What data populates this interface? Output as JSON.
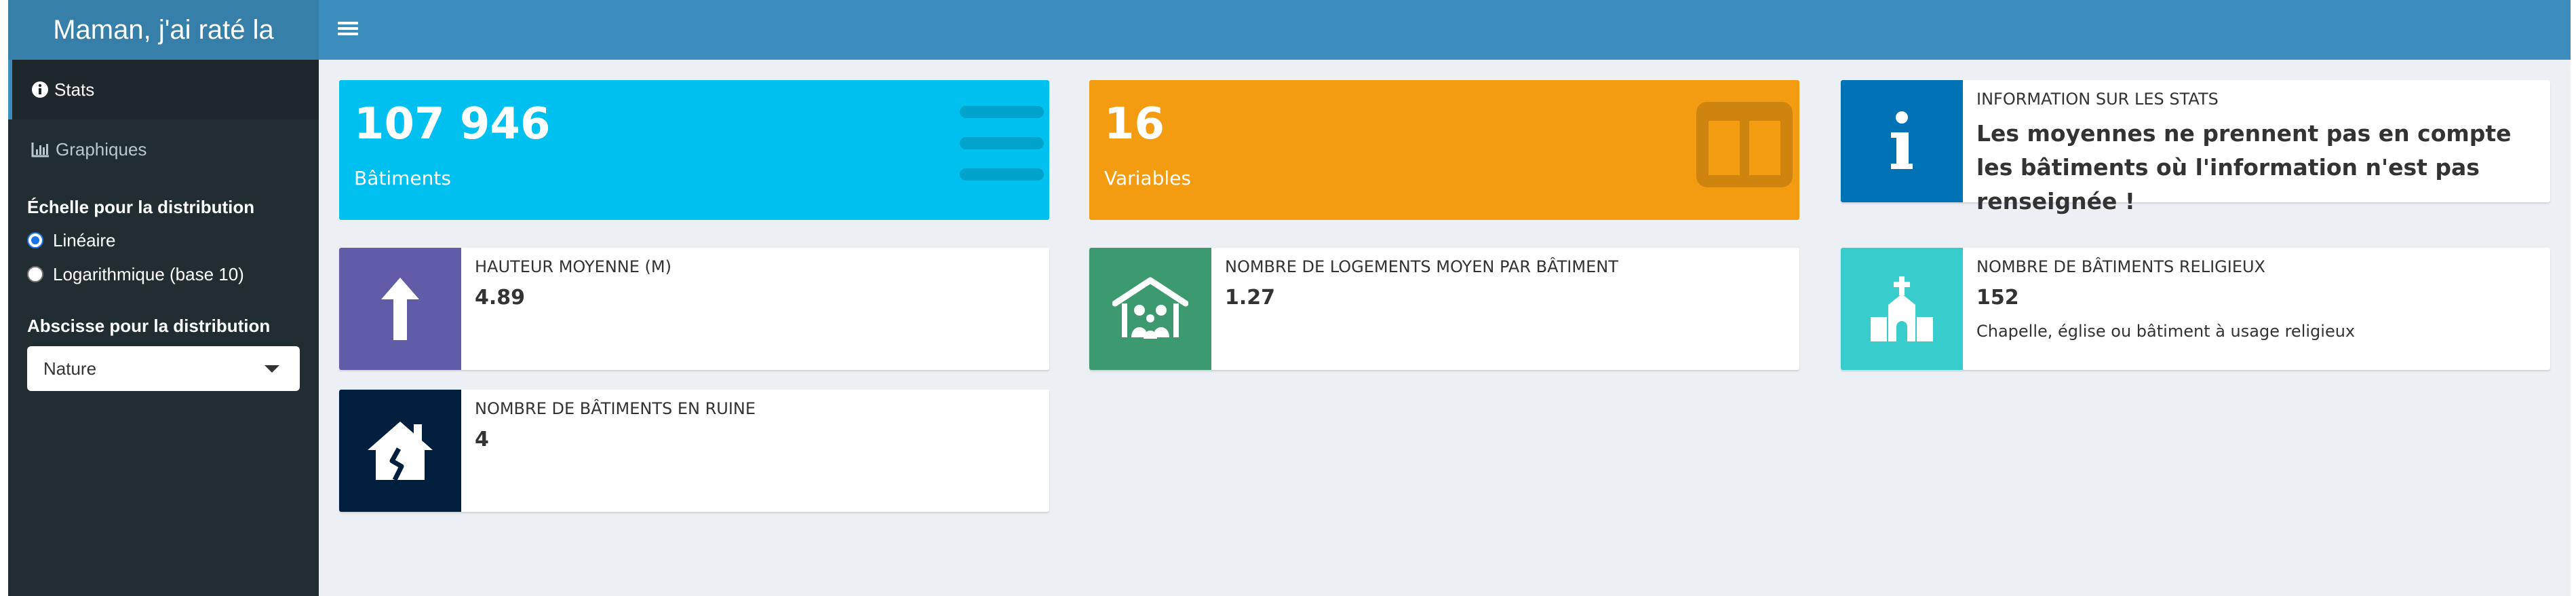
{
  "app": {
    "title": "Maman, j'ai raté la"
  },
  "sidebar": {
    "menu": [
      {
        "label": "Stats",
        "icon": "info-circle-icon",
        "active": true
      },
      {
        "label": "Graphiques",
        "icon": "bar-chart-icon",
        "active": false
      }
    ],
    "scale": {
      "label": "Échelle pour la distribution",
      "options": [
        {
          "label": "Linéaire",
          "checked": true
        },
        {
          "label": "Logarithmique (base 10)",
          "checked": false
        }
      ]
    },
    "abscissa": {
      "label": "Abscisse pour la distribution",
      "selected": "Nature"
    }
  },
  "stats": {
    "buildings": {
      "value": "107 946",
      "label": "Bâtiments",
      "color": "#00c0ef",
      "icon": "list-icon"
    },
    "variables": {
      "value": "16",
      "label": "Variables",
      "color": "#f39c12",
      "icon": "columns-icon"
    },
    "info": {
      "title": "INFORMATION SUR LES STATS",
      "text": "Les moyennes ne prennent pas en compte les bâtiments où l'information n'est pas renseignée !",
      "color": "#0073b7",
      "icon": "info-icon"
    },
    "height": {
      "title": "HAUTEUR MOYENNE (M)",
      "value": "4.89",
      "color": "#605ca8",
      "icon": "arrow-up-icon"
    },
    "housing": {
      "title": "NOMBRE DE LOGEMENTS MOYEN PAR BÂTIMENT",
      "value": "1.27",
      "color": "#3d9970",
      "icon": "family-house-icon"
    },
    "religious": {
      "title": "NOMBRE DE BÂTIMENTS RELIGIEUX",
      "value": "152",
      "subtitle": "Chapelle, église ou bâtiment à usage religieux",
      "color": "#39cccc",
      "icon": "church-icon"
    },
    "ruins": {
      "title": "NOMBRE DE BÂTIMENTS EN RUINE",
      "value": "4",
      "color": "#001f3f",
      "icon": "house-crack-icon"
    }
  }
}
